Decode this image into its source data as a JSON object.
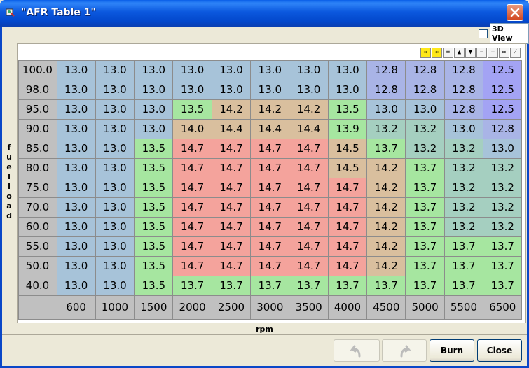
{
  "window": {
    "title": "\"AFR Table 1\""
  },
  "view3d": {
    "label": "3D View",
    "checked": false
  },
  "toolbar": [
    {
      "icon": "arrow-right-icon",
      "glyph": "⇨"
    },
    {
      "icon": "arrow-left-icon",
      "glyph": "⇦"
    },
    {
      "icon": "equals-icon",
      "glyph": "="
    },
    {
      "icon": "triangle-up-icon",
      "glyph": "▲"
    },
    {
      "icon": "triangle-down-icon",
      "glyph": "▼"
    },
    {
      "icon": "minus-icon",
      "glyph": "−"
    },
    {
      "icon": "plus-icon",
      "glyph": "+"
    },
    {
      "icon": "multiply-icon",
      "glyph": "✲"
    },
    {
      "icon": "pencil-icon",
      "glyph": "⁄"
    }
  ],
  "y_axis_label": [
    "f",
    "u",
    "e",
    "l",
    "l",
    "o",
    "a",
    "d"
  ],
  "x_axis_label": "rpm",
  "row_headers": [
    "100.0",
    "98.0",
    "95.0",
    "90.0",
    "85.0",
    "80.0",
    "75.0",
    "70.0",
    "60.0",
    "55.0",
    "50.0",
    "40.0"
  ],
  "col_headers": [
    "600",
    "1000",
    "1500",
    "2000",
    "2500",
    "3000",
    "3500",
    "4000",
    "4500",
    "5000",
    "5500",
    "6500"
  ],
  "cells": [
    [
      "13.0",
      "13.0",
      "13.0",
      "13.0",
      "13.0",
      "13.0",
      "13.0",
      "13.0",
      "12.8",
      "12.8",
      "12.8",
      "12.5"
    ],
    [
      "13.0",
      "13.0",
      "13.0",
      "13.0",
      "13.0",
      "13.0",
      "13.0",
      "13.0",
      "12.8",
      "12.8",
      "12.8",
      "12.5"
    ],
    [
      "13.0",
      "13.0",
      "13.0",
      "13.5",
      "14.2",
      "14.2",
      "14.2",
      "13.5",
      "13.0",
      "13.0",
      "12.8",
      "12.5"
    ],
    [
      "13.0",
      "13.0",
      "13.0",
      "14.0",
      "14.4",
      "14.4",
      "14.4",
      "13.9",
      "13.2",
      "13.2",
      "13.0",
      "12.8"
    ],
    [
      "13.0",
      "13.0",
      "13.5",
      "14.7",
      "14.7",
      "14.7",
      "14.7",
      "14.5",
      "13.7",
      "13.2",
      "13.2",
      "13.0"
    ],
    [
      "13.0",
      "13.0",
      "13.5",
      "14.7",
      "14.7",
      "14.7",
      "14.7",
      "14.5",
      "14.2",
      "13.7",
      "13.2",
      "13.2"
    ],
    [
      "13.0",
      "13.0",
      "13.5",
      "14.7",
      "14.7",
      "14.7",
      "14.7",
      "14.7",
      "14.2",
      "13.7",
      "13.2",
      "13.2"
    ],
    [
      "13.0",
      "13.0",
      "13.5",
      "14.7",
      "14.7",
      "14.7",
      "14.7",
      "14.7",
      "14.2",
      "13.7",
      "13.2",
      "13.2"
    ],
    [
      "13.0",
      "13.0",
      "13.5",
      "14.7",
      "14.7",
      "14.7",
      "14.7",
      "14.7",
      "14.2",
      "13.7",
      "13.2",
      "13.2"
    ],
    [
      "13.0",
      "13.0",
      "13.5",
      "14.7",
      "14.7",
      "14.7",
      "14.7",
      "14.7",
      "14.2",
      "13.7",
      "13.7",
      "13.7"
    ],
    [
      "13.0",
      "13.0",
      "13.5",
      "14.7",
      "14.7",
      "14.7",
      "14.7",
      "14.7",
      "14.2",
      "13.7",
      "13.7",
      "13.7"
    ],
    [
      "13.0",
      "13.0",
      "13.5",
      "13.7",
      "13.7",
      "13.7",
      "13.7",
      "13.7",
      "13.7",
      "13.7",
      "13.7",
      "13.7"
    ]
  ],
  "colors": {
    "rich_purple": "#a3a3f4",
    "rich_purple_light": "#a9b4e6",
    "blue": "#a7c3d9",
    "teal": "#a5cfc0",
    "green": "#a6e6a0",
    "tan": "#d9bf9e",
    "red": "#f4a39c",
    "title_bar": "#0a5fe8",
    "close": "#d2451f"
  },
  "buttons": {
    "undo": {
      "icon": "undo-icon",
      "enabled": false
    },
    "redo": {
      "icon": "redo-icon",
      "enabled": false
    },
    "burn": "Burn",
    "close": "Close"
  }
}
